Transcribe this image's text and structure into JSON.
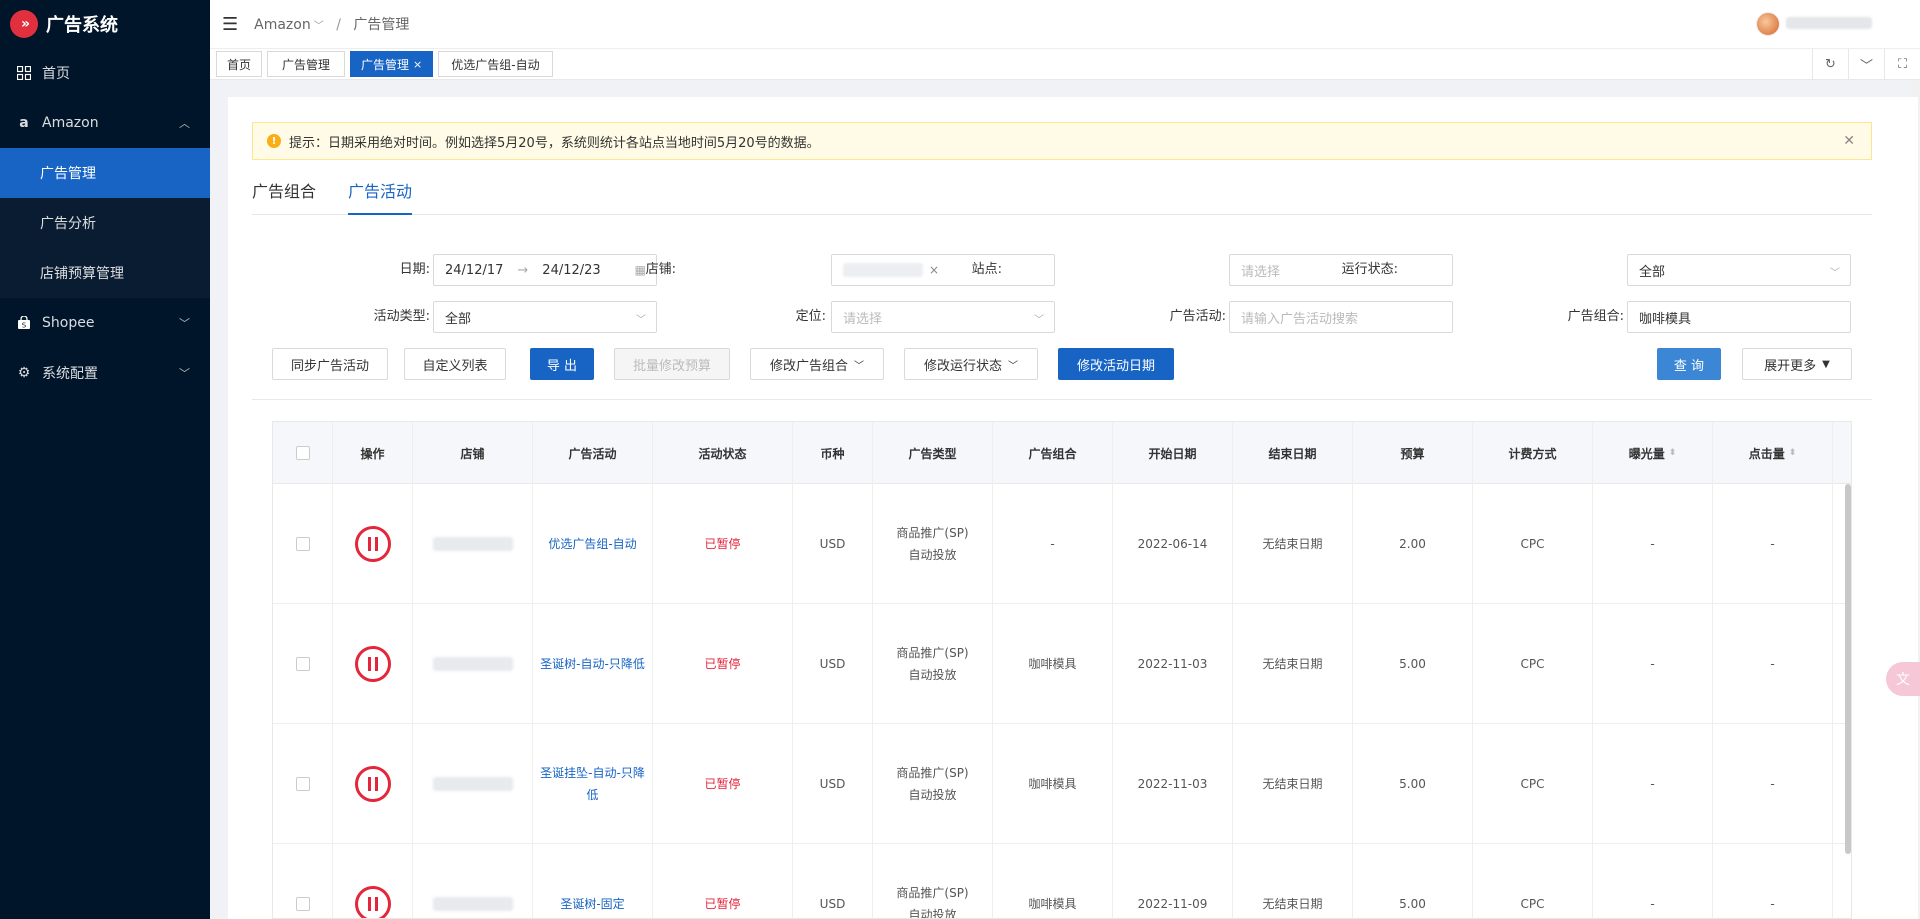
{
  "app": {
    "title": "广告系统"
  },
  "sidebar": {
    "items": [
      {
        "label": "首页",
        "icon": "grid-icon"
      },
      {
        "label": "Amazon",
        "icon": "amazon-icon",
        "expanded": true,
        "children": [
          {
            "label": "广告管理",
            "active": true
          },
          {
            "label": "广告分析"
          },
          {
            "label": "店铺预算管理"
          }
        ]
      },
      {
        "label": "Shopee",
        "icon": "shopee-bag-icon"
      },
      {
        "label": "系统配置",
        "icon": "gear-icon"
      }
    ]
  },
  "header": {
    "breadcrumb": [
      "Amazon",
      "广告管理"
    ]
  },
  "tags": [
    "首页",
    "广告管理",
    "广告管理",
    "优选广告组-自动"
  ],
  "alert": {
    "text": "提示：日期采用绝对时间。例如选择5月20号，系统则统计各站点当地时间5月20号的数据。"
  },
  "tabs": [
    "广告组合",
    "广告活动"
  ],
  "filters": {
    "date_label": "日期:",
    "date_start": "24/12/17",
    "date_end": "24/12/23",
    "shop_label": "店铺:",
    "site_label": "站点:",
    "site_placeholder": "请选择",
    "run_status_label": "运行状态:",
    "run_status_value": "全部",
    "activity_type_label": "活动类型:",
    "activity_type_value": "全部",
    "targeting_label": "定位:",
    "targeting_placeholder": "请选择",
    "campaign_label": "广告活动:",
    "campaign_placeholder": "请输入广告活动搜索",
    "portfolio_label": "广告组合:",
    "portfolio_value": "咖啡模具"
  },
  "toolbar": {
    "sync": "同步广告活动",
    "custom_columns": "自定义列表",
    "export": "导 出",
    "batch_budget": "批量修改预算",
    "edit_portfolio": "修改广告组合",
    "edit_run_status": "修改运行状态",
    "edit_dates": "修改活动日期",
    "query": "查 询",
    "expand_more": "展开更多"
  },
  "table": {
    "columns": [
      "操作",
      "店铺",
      "广告活动",
      "活动状态",
      "币种",
      "广告类型",
      "广告组合",
      "开始日期",
      "结束日期",
      "预算",
      "计费方式",
      "曝光量",
      "点击量"
    ],
    "rows": [
      {
        "campaign": "优选广告组-自动",
        "status": "已暂停",
        "currency": "USD",
        "type_line1": "商品推广(SP)",
        "type_line2": "自动投放",
        "portfolio": "-",
        "start": "2022-06-14",
        "end": "无结束日期",
        "budget": "2.00",
        "billing": "CPC",
        "impressions": "-",
        "clicks": "-"
      },
      {
        "campaign": "圣诞树-自动-只降低",
        "status": "已暂停",
        "currency": "USD",
        "type_line1": "商品推广(SP)",
        "type_line2": "自动投放",
        "portfolio": "咖啡模具",
        "start": "2022-11-03",
        "end": "无结束日期",
        "budget": "5.00",
        "billing": "CPC",
        "impressions": "-",
        "clicks": "-"
      },
      {
        "campaign": "圣诞挂坠-自动-只降低",
        "status": "已暂停",
        "currency": "USD",
        "type_line1": "商品推广(SP)",
        "type_line2": "自动投放",
        "portfolio": "咖啡模具",
        "start": "2022-11-03",
        "end": "无结束日期",
        "budget": "5.00",
        "billing": "CPC",
        "impressions": "-",
        "clicks": "-"
      },
      {
        "campaign": "圣诞树-固定",
        "status": "已暂停",
        "currency": "USD",
        "type_line1": "商品推广(SP)",
        "type_line2": "自动投放",
        "portfolio": "咖啡模具",
        "start": "2022-11-09",
        "end": "无结束日期",
        "budget": "5.00",
        "billing": "CPC",
        "impressions": "-",
        "clicks": "-"
      }
    ]
  }
}
